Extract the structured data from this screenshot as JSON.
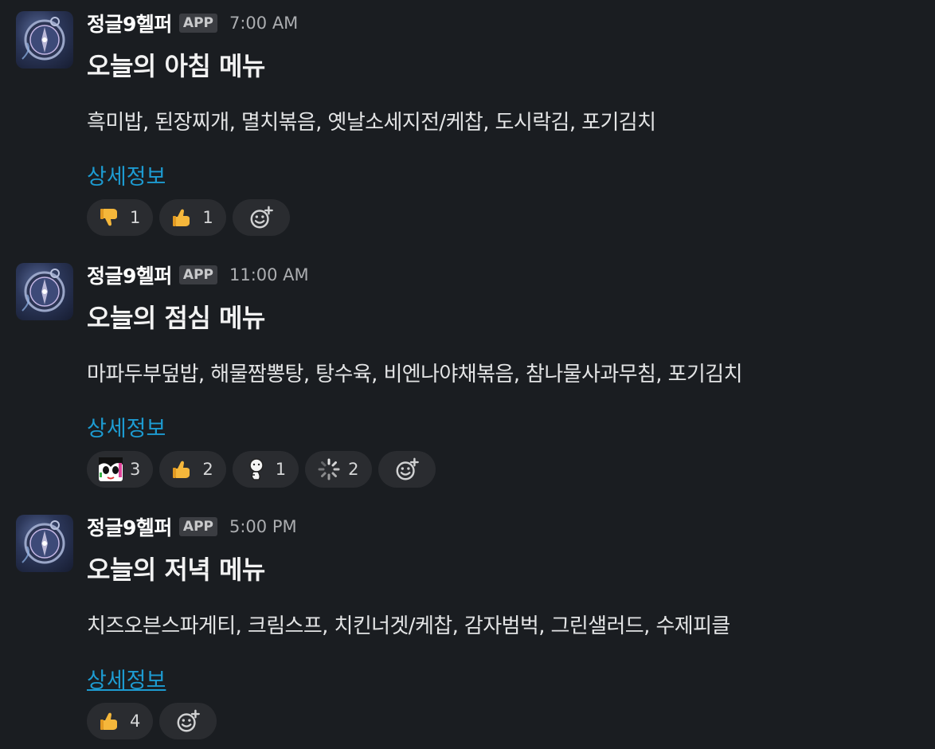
{
  "messages": [
    {
      "sender": "정글9헬퍼",
      "badge": "APP",
      "time": "7:00 AM",
      "title": "오늘의 아침 메뉴",
      "menu": "흑미밥, 된장찌개, 멸치볶음, 옛날소세지전/케찹, 도시락김, 포기김치",
      "link": "상세정보",
      "reactions": [
        {
          "emoji": "thumbs-down-icon",
          "count": "1"
        },
        {
          "emoji": "thumbs-up-icon",
          "count": "1"
        }
      ]
    },
    {
      "sender": "정글9헬퍼",
      "badge": "APP",
      "time": "11:00 AM",
      "title": "오늘의 점심 메뉴",
      "menu": "마파두부덮밥, 해물짬뽕탕, 탕수육, 비엔나야채볶음, 참나물사과무침, 포기김치",
      "link": "상세정보",
      "reactions": [
        {
          "emoji": "anime-face-icon",
          "count": "3"
        },
        {
          "emoji": "thumbs-up-icon",
          "count": "2"
        },
        {
          "emoji": "character-icon",
          "count": "1"
        },
        {
          "emoji": "loading-icon",
          "count": "2"
        }
      ]
    },
    {
      "sender": "정글9헬퍼",
      "badge": "APP",
      "time": "5:00 PM",
      "title": "오늘의 저녁 메뉴",
      "menu": "치즈오븐스파게티, 크림스프, 치킨너겟/케찹, 감자범벅, 그린샐러드, 수제피클",
      "link": "상세정보",
      "reactions": [
        {
          "emoji": "thumbs-up-icon",
          "count": "4"
        }
      ]
    }
  ],
  "colors": {
    "background": "#1a1d21",
    "link": "#1d9bd1",
    "reaction_bg": "#2a2c30",
    "thumb": "#f5b73b"
  }
}
